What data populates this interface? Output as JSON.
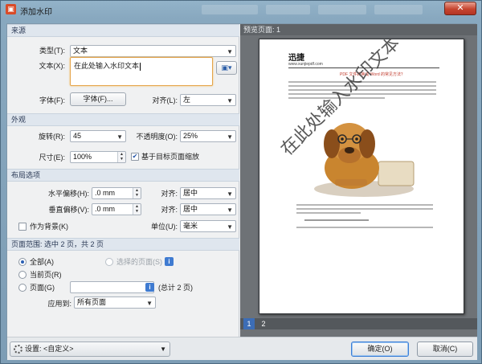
{
  "window": {
    "title": "添加水印",
    "close_label": "✕"
  },
  "source": {
    "section": "来源",
    "type_label": "类型(T):",
    "type_value": "文本",
    "text_label": "文本(X):",
    "text_value": "在此处输入水印文本",
    "font_label": "字体(F):",
    "font_button": "字体(F)...",
    "align_label": "对齐(L):",
    "align_value": "左"
  },
  "appearance": {
    "section": "外观",
    "rotation_label": "旋转(R):",
    "rotation_value": "45",
    "opacity_label": "不透明度(O):",
    "opacity_value": "25%",
    "size_label": "尺寸(E):",
    "size_value": "100%",
    "scale_label": "基于目标页面缩放",
    "scale_checked": true
  },
  "layout": {
    "section": "布局选项",
    "hoffset_label": "水平偏移(H):",
    "hoffset_value": ".0 mm",
    "voffset_label": "垂直偏移(V):",
    "voffset_value": ".0 mm",
    "halign_label": "对齐:",
    "halign_value": "居中",
    "valign_label": "对齐:",
    "valign_value": "居中",
    "background_label": "作为背景(K)",
    "background_checked": false,
    "unit_label": "单位(U):",
    "unit_value": "毫米"
  },
  "range": {
    "section": "页面范围: 选中 2 页，共 2 页",
    "all_label": "全部(A)",
    "selected_label": "选择的页面(S)",
    "current_label": "当前页(R)",
    "pages_label": "页面(G)",
    "pages_value": "",
    "total_label": "(总计 2 页)",
    "apply_label": "应用到:",
    "apply_value": "所有页面",
    "selected_option": "all"
  },
  "preview": {
    "header": "预览页面: 1",
    "page_title": "迅捷",
    "page_subtitle": "www.xunjiepdf.com",
    "link_line": "PDF 文件转换成 Word 的常见方法？",
    "watermark_text": "在此处输入水印文本",
    "pages": [
      "1",
      "2"
    ],
    "current_page": "1"
  },
  "footer": {
    "settings_label": "设置:",
    "settings_value": "<自定义>",
    "ok_label": "确定(O)",
    "cancel_label": "取消(C)"
  }
}
